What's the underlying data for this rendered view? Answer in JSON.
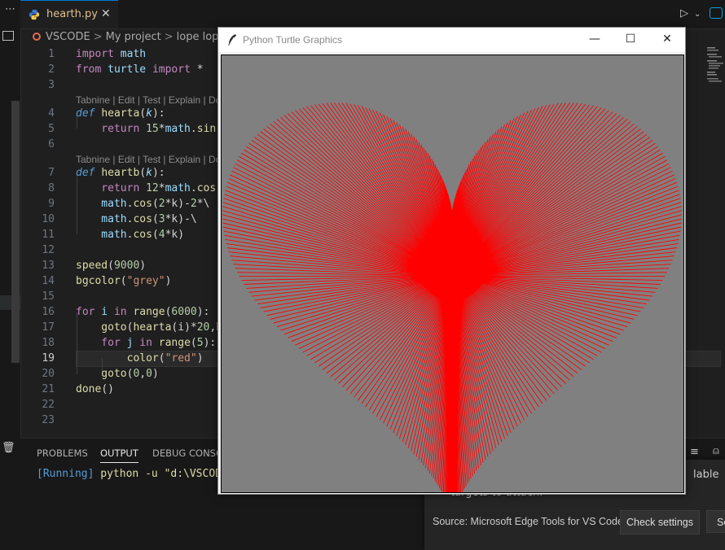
{
  "editor": {
    "tab": {
      "file_name": "hearth.py",
      "close_glyph": "✕"
    },
    "breadcrumb": [
      "VSCODE",
      "My project",
      "lope lope"
    ],
    "codelens": "Tabnine | Edit | Test | Explain | Doc",
    "lines": [
      {
        "n": "1"
      },
      {
        "n": "2"
      },
      {
        "n": "3"
      },
      {
        "n": "4"
      },
      {
        "n": "5"
      },
      {
        "n": "6"
      },
      {
        "n": "7"
      },
      {
        "n": "8"
      },
      {
        "n": "9"
      },
      {
        "n": "10"
      },
      {
        "n": "11"
      },
      {
        "n": "12"
      },
      {
        "n": "13"
      },
      {
        "n": "14"
      },
      {
        "n": "15"
      },
      {
        "n": "16"
      },
      {
        "n": "17"
      },
      {
        "n": "18"
      },
      {
        "n": "19"
      },
      {
        "n": "20"
      },
      {
        "n": "21"
      },
      {
        "n": "22"
      },
      {
        "n": "23"
      }
    ],
    "code": {
      "l1": [
        "import",
        " math"
      ],
      "l2": [
        "from",
        " turtle ",
        "import",
        " *"
      ],
      "l4": [
        "def",
        " ",
        "hearta",
        "(",
        "k",
        "):"
      ],
      "l5": [
        "    return ",
        "15",
        "*",
        "math",
        ".",
        "sin("
      ],
      "l7": [
        "def",
        " ",
        "heartb",
        "(",
        "k",
        "):"
      ],
      "l8": [
        "    return ",
        "12",
        "*",
        "math",
        ".",
        "cos("
      ],
      "l9": [
        "    math",
        ".",
        "cos",
        "(",
        "2",
        "*k)-",
        "2",
        "*\\"
      ],
      "l10": [
        "    math",
        ".",
        "cos",
        "(",
        "3",
        "*k)-\\"
      ],
      "l11": [
        "    math",
        ".",
        "cos",
        "(",
        "4",
        "*k)"
      ],
      "l13": [
        "speed",
        "(",
        "9000",
        ")"
      ],
      "l14": [
        "bgcolor",
        "(",
        "\"grey\"",
        ")"
      ],
      "l16": [
        "for",
        " i ",
        "in",
        " ",
        "range",
        "(",
        "6000",
        "):"
      ],
      "l17": [
        "    goto",
        "(",
        "hearta",
        "(i)*",
        "20",
        ",h"
      ],
      "l18": [
        "    for",
        " j ",
        "in",
        " ",
        "range",
        "(",
        "5",
        "):"
      ],
      "l19": [
        "        color",
        "(",
        "\"red\"",
        ")"
      ],
      "l20": [
        "    goto",
        "(",
        "0",
        ",",
        "0",
        ")"
      ],
      "l21": [
        "done",
        "()"
      ]
    }
  },
  "panel": {
    "tabs": [
      "PROBLEMS",
      "OUTPUT",
      "DEBUG CONSOL"
    ],
    "output": {
      "status": "[Running]",
      "command": " python -u \"d:\\VSCOD"
    }
  },
  "toast": {
    "line1": "lable",
    "line2": "targets to attach.",
    "source": "Source: Microsoft Edge Tools for VS Code",
    "check_settings": "Check settings",
    "second_button": "Se"
  },
  "turtle_window": {
    "title": "Python Turtle Graphics",
    "minimize": "—",
    "maximize": "☐",
    "close": "✕",
    "background": "#808080",
    "pen_color": "#ff0000"
  }
}
